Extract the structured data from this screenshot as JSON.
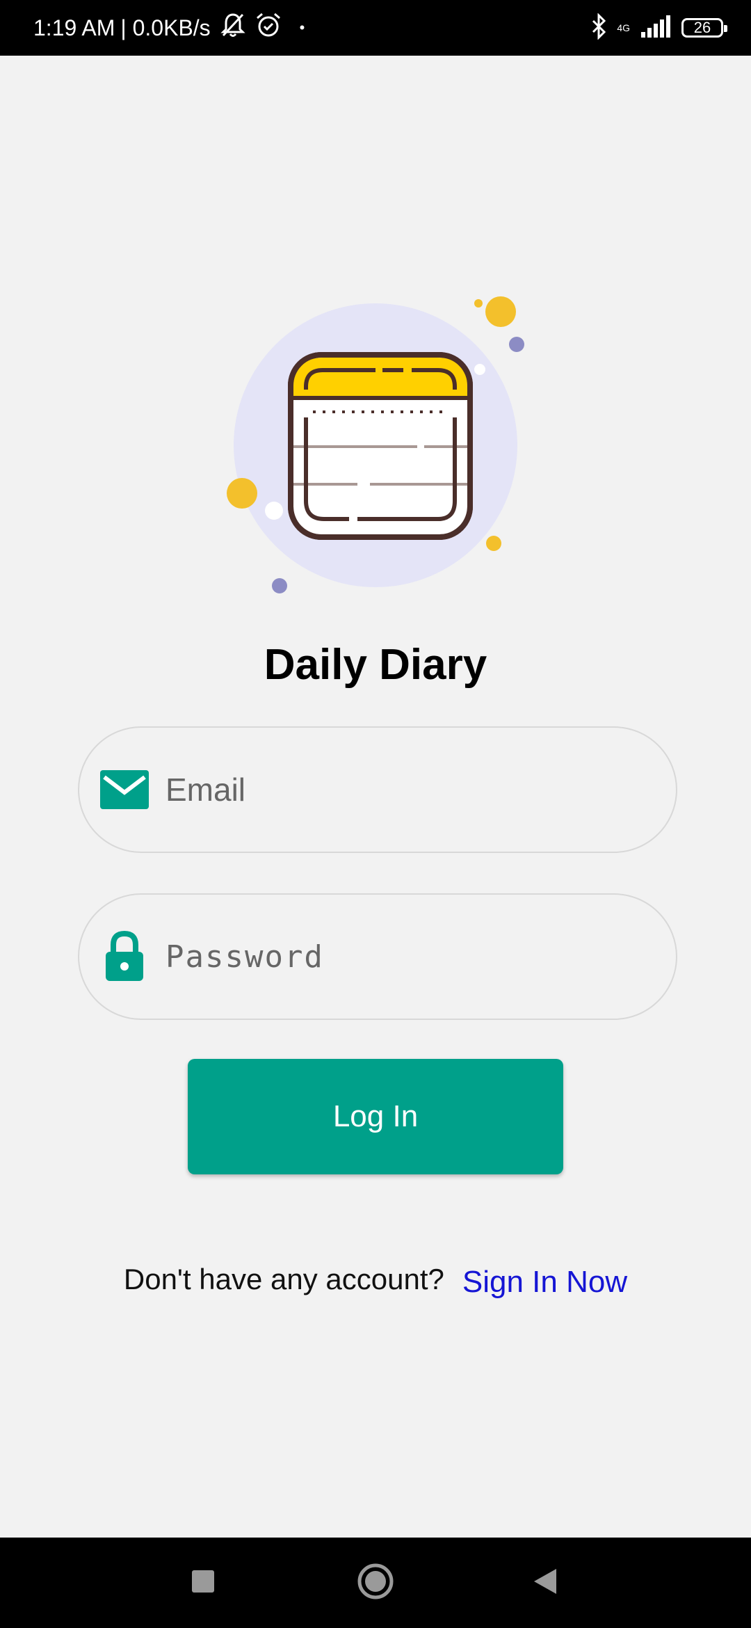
{
  "status_bar": {
    "time": "1:19 AM",
    "speed": "| 0.0KB/s",
    "dot": "•",
    "network": "4G",
    "battery": "26",
    "icons": [
      "bell-off-icon",
      "alarm-icon",
      "bluetooth-icon",
      "signal-icon",
      "battery-icon"
    ]
  },
  "app": {
    "title": "Daily Diary",
    "logo_icon": "notepad-icon"
  },
  "form": {
    "email_placeholder": "Email",
    "email_value": "",
    "email_icon": "mail-icon",
    "password_placeholder": "Password",
    "password_value": "",
    "password_icon": "lock-icon",
    "login_label": "Log In"
  },
  "signup": {
    "prompt": "Don't have any account?",
    "link": "Sign In Now"
  },
  "nav": {
    "icons": [
      "recents-square-icon",
      "home-circle-icon",
      "back-triangle-icon"
    ]
  },
  "colors": {
    "accent": "#00a08a",
    "link": "#1515d4",
    "background": "#f2f2f2",
    "logo_yellow": "#ffd000",
    "logo_circle": "#e4e4f7"
  }
}
